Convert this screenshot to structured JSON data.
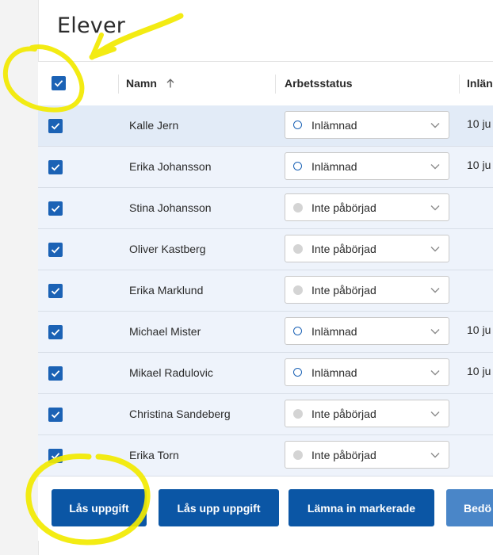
{
  "page": {
    "title": "Elever"
  },
  "table": {
    "columns": {
      "name": "Namn",
      "status": "Arbetsstatus",
      "submitted": "Inlän"
    },
    "rows": [
      {
        "name": "Kalle Jern",
        "status": "Inlämnad",
        "date": "10 ju"
      },
      {
        "name": "Erika Johansson",
        "status": "Inlämnad",
        "date": "10 ju"
      },
      {
        "name": "Stina Johansson",
        "status": "Inte påbörjad",
        "date": ""
      },
      {
        "name": "Oliver Kastberg",
        "status": "Inte påbörjad",
        "date": ""
      },
      {
        "name": "Erika Marklund",
        "status": "Inte påbörjad",
        "date": ""
      },
      {
        "name": "Michael Mister",
        "status": "Inlämnad",
        "date": "10 ju"
      },
      {
        "name": "Mikael Radulovic",
        "status": "Inlämnad",
        "date": "10 ju"
      },
      {
        "name": "Christina Sandeberg",
        "status": "Inte påbörjad",
        "date": ""
      },
      {
        "name": "Erika Torn",
        "status": "Inte påbörjad",
        "date": ""
      }
    ]
  },
  "actions": {
    "lock": "Lås uppgift",
    "unlock": "Lås upp uppgift",
    "submit_selected": "Lämna in markerade",
    "grade": "Bedö"
  },
  "colors": {
    "accent": "#0b56a5",
    "checkbox": "#1b62b5",
    "highlight": "#f2ea00"
  }
}
